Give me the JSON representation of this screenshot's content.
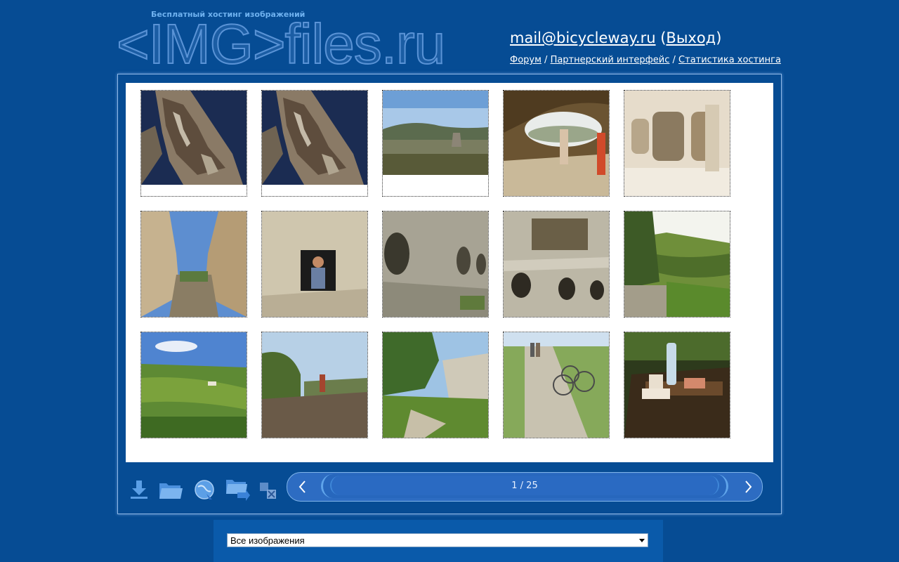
{
  "header": {
    "tagline": "Бесплатный хостинг изображений",
    "logo_text": "<IMG>files.ru",
    "user_email": "mail@bicycleway.ru",
    "logout_label": "Выход",
    "nav": [
      {
        "label": "Форум"
      },
      {
        "label": "Партнерский интерфейс"
      },
      {
        "label": "Статистика хостинга"
      }
    ]
  },
  "gallery": {
    "thumbnails": [
      {
        "subject": "aerial-coast-a"
      },
      {
        "subject": "aerial-coast-b"
      },
      {
        "subject": "valley-panorama"
      },
      {
        "subject": "cave-opening-people"
      },
      {
        "subject": "cave-interior"
      },
      {
        "subject": "canyon-path"
      },
      {
        "subject": "person-in-cave-window"
      },
      {
        "subject": "rock-caves"
      },
      {
        "subject": "carved-rock-holes"
      },
      {
        "subject": "green-valley-view"
      },
      {
        "subject": "vineyard-hills"
      },
      {
        "subject": "hiker-on-rock"
      },
      {
        "subject": "forest-trail"
      },
      {
        "subject": "bicycles-on-trail"
      },
      {
        "subject": "picnic-table"
      }
    ]
  },
  "toolbar": {
    "icons": [
      "download-icon",
      "folder-icon",
      "globe-icon",
      "move-folder-icon",
      "delete-icon"
    ]
  },
  "pager": {
    "current_page": 1,
    "total_pages": 25,
    "label": "1 / 25"
  },
  "filter": {
    "selected": "Все изображения"
  },
  "colors": {
    "background": "#064c94",
    "accent": "#2d6cc2",
    "link": "#ffffff"
  }
}
